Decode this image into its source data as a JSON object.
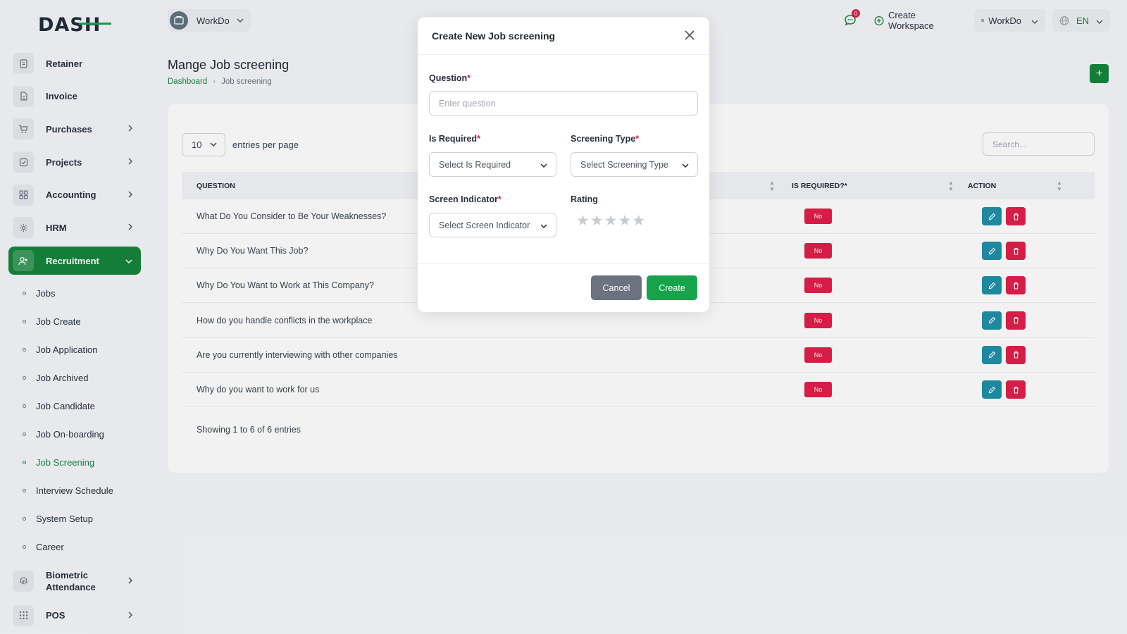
{
  "logo": "DASH",
  "sidebar": {
    "items": [
      {
        "name": "retainer",
        "label": "Retainer",
        "icon": "retainer-icon"
      },
      {
        "name": "invoice",
        "label": "Invoice",
        "icon": "invoice-icon"
      },
      {
        "name": "purchases",
        "label": "Purchases",
        "icon": "cart-icon"
      },
      {
        "name": "projects",
        "label": "Projects",
        "icon": "projects-icon"
      },
      {
        "name": "accounting",
        "label": "Accounting",
        "icon": "grid-icon"
      },
      {
        "name": "hrm",
        "label": "HRM",
        "icon": "hrm-icon"
      },
      {
        "name": "recruitment",
        "label": "Recruitment",
        "icon": "user-plus-icon"
      }
    ],
    "sub_items": [
      "Jobs",
      "Job Create",
      "Job Application",
      "Job Archived",
      "Job Candidate",
      "Job On-boarding",
      "Job Screening",
      "Interview Schedule",
      "System Setup",
      "Career"
    ],
    "bottom_items": [
      {
        "name": "biometric-attendance",
        "label": "Biometric Attendance",
        "icon": "fingerprint-icon"
      },
      {
        "name": "pos",
        "label": "POS",
        "icon": "dots-grid-icon"
      }
    ]
  },
  "topbar": {
    "workspace": "WorkDo",
    "notifications_count": "0",
    "create_workspace": "Create Workspace",
    "workspace_menu": "WorkDo",
    "language": "EN"
  },
  "page": {
    "title": "Mange Job screening",
    "breadcrumb": [
      "Dashboard",
      "Job screening"
    ]
  },
  "table": {
    "entries_value": "10",
    "entries_label": "entries per page",
    "search_placeholder": "Search...",
    "columns": [
      "QUESTION",
      "IS REQUIRED?*",
      "ACTION"
    ],
    "rows": [
      {
        "question": "What Do You Consider to Be Your Weaknesses?",
        "required": "No"
      },
      {
        "question": "Why Do You Want This Job?",
        "required": "No"
      },
      {
        "question": "Why Do You Want to Work at This Company?",
        "required": "No"
      },
      {
        "question": "How do you handle conflicts in the workplace",
        "required": "No"
      },
      {
        "question": "Are you currently interviewing with other companies",
        "required": "No"
      },
      {
        "question": "Why do you want to work for us",
        "required": "No"
      }
    ],
    "footer": "Showing 1 to 6 of 6 entries"
  },
  "modal": {
    "title": "Create New Job screening",
    "question_label": "Question",
    "question_placeholder": "Enter question",
    "is_required_label": "Is Required",
    "is_required_value": "Select Is Required",
    "screening_type_label": "Screening Type",
    "screening_type_value": "Select Screening Type",
    "screen_indicator_label": "Screen Indicator",
    "screen_indicator_value": "Select Screen Indicator",
    "rating_label": "Rating",
    "rating_value": 0,
    "rating_max": 5,
    "cancel_label": "Cancel",
    "create_label": "Create",
    "required_mark": "*"
  },
  "colors": {
    "primary": "#14843a",
    "danger": "#e11d48",
    "info": "#1d8fa5"
  }
}
